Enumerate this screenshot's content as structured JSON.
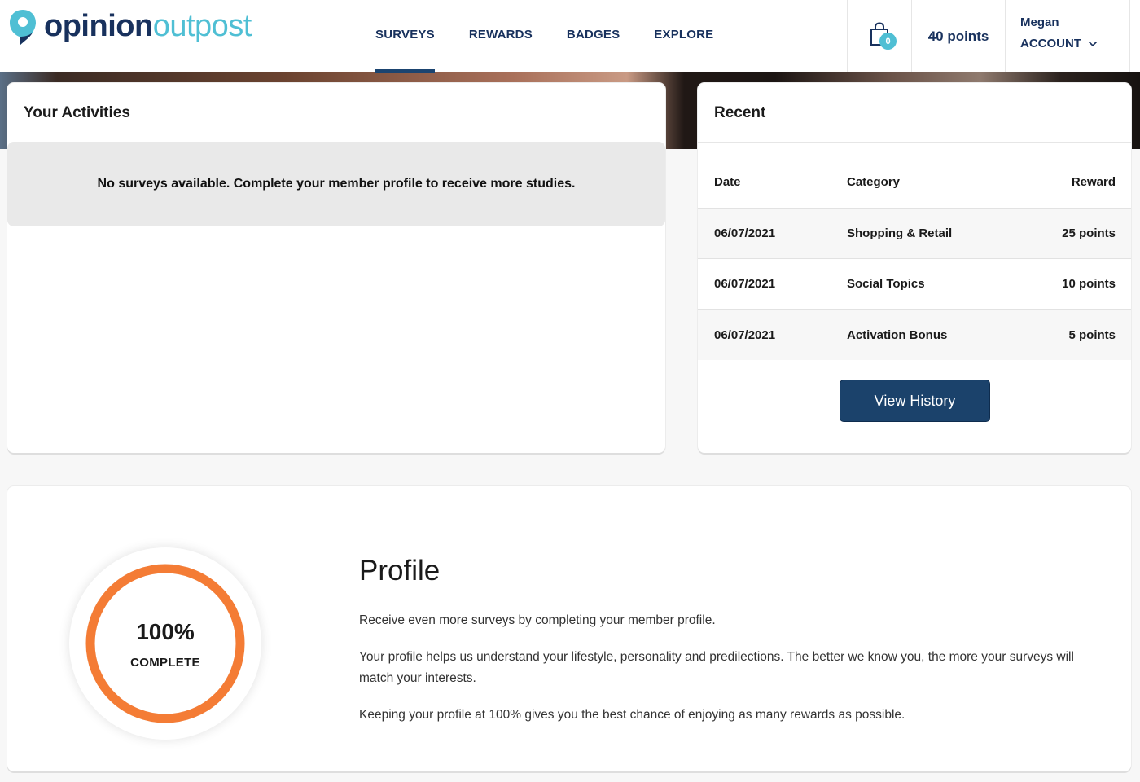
{
  "brand": {
    "name_part1": "opinion",
    "name_part2": "outpost",
    "primary_color": "#18315d",
    "accent_color": "#4fbfd4"
  },
  "nav": {
    "items": [
      {
        "label": "SURVEYS",
        "active": true
      },
      {
        "label": "REWARDS",
        "active": false
      },
      {
        "label": "BADGES",
        "active": false
      },
      {
        "label": "EXPLORE",
        "active": false
      }
    ]
  },
  "header": {
    "cart_icon": "shopping-bag-icon",
    "cart_count": "0",
    "points": "40 points",
    "user_name": "Megan",
    "account_label": "ACCOUNT",
    "account_icon": "chevron-down-icon"
  },
  "activities": {
    "title": "Your Activities",
    "empty_message": "No surveys available. Complete your member profile to receive more studies."
  },
  "recent": {
    "title": "Recent",
    "columns": [
      "Date",
      "Category",
      "Reward"
    ],
    "rows": [
      {
        "date": "06/07/2021",
        "category": "Shopping & Retail",
        "reward": "25 points"
      },
      {
        "date": "06/07/2021",
        "category": "Social Topics",
        "reward": "10 points"
      },
      {
        "date": "06/07/2021",
        "category": "Activation Bonus",
        "reward": "5 points"
      }
    ],
    "button_label": "View History",
    "button_color": "#1b426b"
  },
  "profile": {
    "progress_percent": 100,
    "percent_label": "100%",
    "complete_label": "COMPLETE",
    "ring_color": "#f47c35",
    "title": "Profile",
    "paragraphs": [
      "Receive even more surveys by completing your member profile.",
      "Your profile helps us understand your lifestyle, personality and predilections. The better we know you, the more your surveys will match your interests.",
      "Keeping your profile at 100% gives you the best chance of enjoying as many rewards as possible."
    ]
  }
}
